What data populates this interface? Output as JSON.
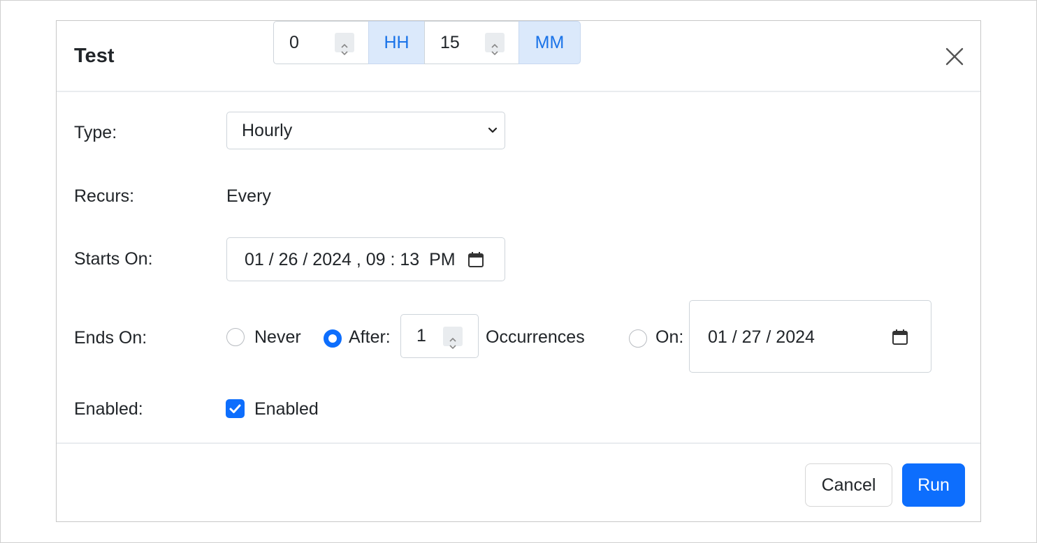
{
  "dialog": {
    "title": "Test",
    "close_icon": "close-icon"
  },
  "form": {
    "type": {
      "label": "Type:",
      "selected": "Hourly",
      "icon": "chevron-down-icon"
    },
    "recurs": {
      "label": "Recurs:",
      "prefix": "Every",
      "hours_value": "0",
      "hours_unit": "HH",
      "minutes_value": "15",
      "minutes_unit": "MM"
    },
    "starts_on": {
      "label": "Starts On:",
      "value": "01 / 26 / 2024 , 09 : 13  PM",
      "icon": "calendar-icon"
    },
    "ends_on": {
      "label": "Ends On:",
      "never_label": "Never",
      "after_label": "After:",
      "after_value": "1",
      "occurrences_label": "Occurrences",
      "on_label": "On:",
      "on_date": "01 / 27 / 2024",
      "selected": "after"
    },
    "enabled": {
      "label": "Enabled:",
      "checkbox_label": "Enabled",
      "checked": true
    }
  },
  "footer": {
    "cancel_label": "Cancel",
    "run_label": "Run"
  },
  "colors": {
    "primary": "#0d6efd",
    "unit_bg": "#dbe9fb",
    "unit_text": "#1a73e8"
  }
}
